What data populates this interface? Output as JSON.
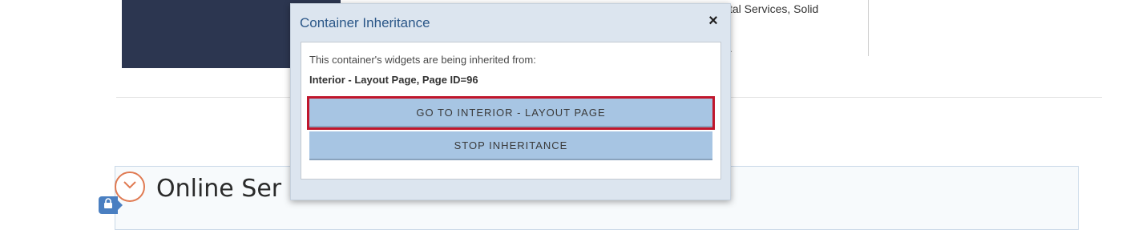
{
  "background": {
    "top_text": "tal Services, Solid",
    "small_text": "t.",
    "section_heading": "Online Ser"
  },
  "modal": {
    "title": "Container Inheritance",
    "close_label": "×",
    "inherit_message": "This container's widgets are being inherited from:",
    "inherit_source": "Interior - Layout Page, Page ID=96",
    "goto_button_label": "GO TO INTERIOR - LAYOUT PAGE",
    "stop_button_label": "STOP INHERITANCE"
  },
  "colors": {
    "accent_title": "#2b5788",
    "button_bg": "#a7c5e3",
    "highlight_border": "#c0162c",
    "dark_panel": "#2c3650",
    "chevron_circle": "#e07a52"
  }
}
